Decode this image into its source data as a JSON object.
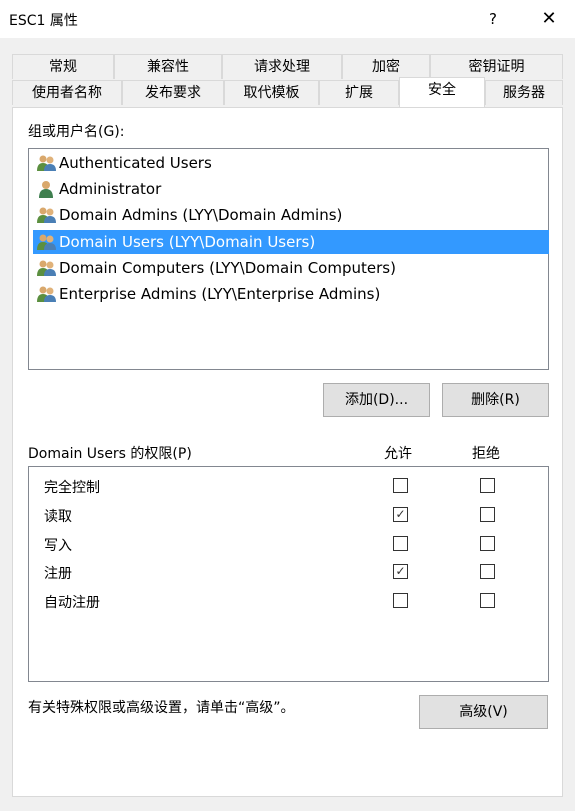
{
  "window": {
    "title": "ESC1 属性",
    "help": "?",
    "close": "✕"
  },
  "tabs_row1": [
    "常规",
    "兼容性",
    "请求处理",
    "加密",
    "密钥证明"
  ],
  "tabs_row2": [
    "使用者名称",
    "发布要求",
    "取代模板",
    "扩展",
    "安全",
    "服务器"
  ],
  "active_tab": "安全",
  "groups": {
    "label": "组或用户名(G):",
    "items": [
      {
        "name": "Authenticated Users",
        "icon": "group-icon",
        "selected": false
      },
      {
        "name": "Administrator",
        "icon": "user-icon",
        "selected": false
      },
      {
        "name": "Domain Admins (LYY\\Domain Admins)",
        "icon": "group-icon",
        "selected": false
      },
      {
        "name": "Domain Users (LYY\\Domain Users)",
        "icon": "group-icon",
        "selected": true
      },
      {
        "name": "Domain Computers (LYY\\Domain Computers)",
        "icon": "group-icon",
        "selected": false
      },
      {
        "name": "Enterprise Admins (LYY\\Enterprise Admins)",
        "icon": "group-icon",
        "selected": false
      }
    ]
  },
  "buttons": {
    "add": "添加(D)...",
    "remove": "删除(R)",
    "advanced": "高级(V)"
  },
  "permissions": {
    "label": "Domain Users 的权限(P)",
    "allow_header": "允许",
    "deny_header": "拒绝",
    "rows": [
      {
        "name": "完全控制",
        "allow": false,
        "deny": false
      },
      {
        "name": "读取",
        "allow": true,
        "deny": false
      },
      {
        "name": "写入",
        "allow": false,
        "deny": false
      },
      {
        "name": "注册",
        "allow": true,
        "deny": false
      },
      {
        "name": "自动注册",
        "allow": false,
        "deny": false
      }
    ]
  },
  "footer_note": "有关特殊权限或高级设置，请单击“高级”。",
  "colors": {
    "selection": "#3399ff",
    "background": "#f0f0f0"
  }
}
